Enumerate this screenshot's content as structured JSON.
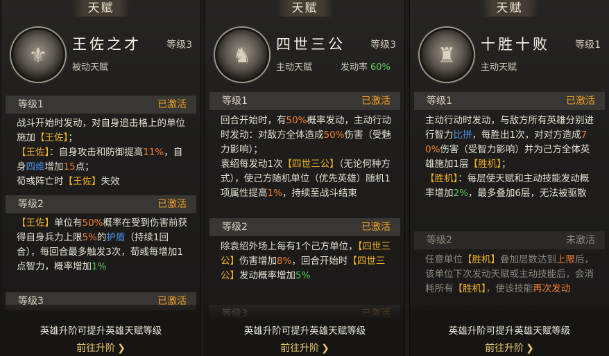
{
  "panels": [
    {
      "title": "天赋",
      "name": "王佐之才",
      "level": "等级3",
      "type": "被动天赋",
      "rate_label": "",
      "rate_value": "",
      "avatar_glyph": "⚜",
      "tiers": [
        {
          "label": "等级1",
          "status": "已激活",
          "active": true,
          "segments": [
            [
              "",
              "战斗开始时发动，对自身追击格上的单位施加"
            ],
            [
              "y",
              "【王佐】"
            ],
            [
              "",
              "；"
            ],
            [
              "br",
              ""
            ],
            [
              "y",
              "【王佐】"
            ],
            [
              "",
              "：自身攻击和防御提高"
            ],
            [
              "o",
              "11%"
            ],
            [
              "",
              "，自身"
            ],
            [
              "b",
              "四维"
            ],
            [
              "",
              "增加"
            ],
            [
              "o",
              "15"
            ],
            [
              "",
              "点；"
            ],
            [
              "br",
              ""
            ],
            [
              "",
              "荀彧阵亡时"
            ],
            [
              "y",
              "【王佐】"
            ],
            [
              "",
              "失效"
            ]
          ]
        },
        {
          "label": "等级2",
          "status": "已激活",
          "active": true,
          "segments": [
            [
              "y",
              "【王佐】"
            ],
            [
              "",
              "单位有"
            ],
            [
              "o",
              "50%"
            ],
            [
              "",
              "概率在受到伤害前获得自身兵力上限"
            ],
            [
              "o",
              "5%"
            ],
            [
              "",
              "的"
            ],
            [
              "b",
              "护盾"
            ],
            [
              "",
              "（持续1回合），每回合最多触发3次，荀彧每增加1点智力，概率增加"
            ],
            [
              "g",
              "1%"
            ]
          ]
        },
        {
          "label": "等级3",
          "status": "已激活",
          "active": true,
          "segments": []
        }
      ],
      "footer_note": "英雄升阶可提升英雄天赋等级",
      "footer_button": "前往升阶"
    },
    {
      "title": "天赋",
      "name": "四世三公",
      "level": "等级3",
      "type": "主动天赋",
      "rate_label": "发动率",
      "rate_value": "60%",
      "avatar_glyph": "♞",
      "tiers": [
        {
          "label": "等级1",
          "status": "已激活",
          "active": true,
          "segments": [
            [
              "",
              "回合开始时，有"
            ],
            [
              "o",
              "50%"
            ],
            [
              "",
              "概率发动，主动行动时发动：对敌方全体造成"
            ],
            [
              "o",
              "50%"
            ],
            [
              "",
              "伤害（受魅力影响）；"
            ],
            [
              "br",
              ""
            ],
            [
              "",
              "袁绍每发动1次"
            ],
            [
              "y",
              "【四世三公】"
            ],
            [
              "",
              "（无论何种方式），使己方随机单位（优先英雄）随机1项属性提高"
            ],
            [
              "o",
              "1%"
            ],
            [
              "",
              "，持续至战斗结束"
            ]
          ]
        },
        {
          "label": "等级2",
          "status": "已激活",
          "active": true,
          "segments": [
            [
              "",
              "除袁绍外场上每有1个己方单位，"
            ],
            [
              "y",
              "【四世三公】"
            ],
            [
              "",
              "伤害增加"
            ],
            [
              "o",
              "8%"
            ],
            [
              "",
              "，回合开始时"
            ],
            [
              "y",
              "【四世三公】"
            ],
            [
              "",
              "发动概率增加"
            ],
            [
              "g",
              "5%"
            ]
          ]
        },
        {
          "label": "等级3",
          "status": "已激活",
          "active": true,
          "segments": []
        }
      ],
      "footer_note": "英雄升阶可提升英雄天赋等级",
      "footer_button": "前往升阶"
    },
    {
      "title": "天赋",
      "name": "十胜十败",
      "level": "等级1",
      "type": "主动天赋",
      "rate_label": "",
      "rate_value": "",
      "avatar_glyph": "♜",
      "tiers": [
        {
          "label": "等级1",
          "status": "已激活",
          "active": true,
          "segments": [
            [
              "",
              "主动行动时发动，与敌方所有英雄分别进行智力"
            ],
            [
              "b",
              "比拼"
            ],
            [
              "",
              "，每胜出1次，对对方造成"
            ],
            [
              "o",
              "70%"
            ],
            [
              "",
              "伤害（受智力影响）并为己方全体英雄施加1层"
            ],
            [
              "y",
              "【胜机】"
            ],
            [
              "",
              "；"
            ],
            [
              "br",
              ""
            ],
            [
              "y",
              "【胜机】"
            ],
            [
              "",
              "：每层使天赋和主动技能发动概率增加"
            ],
            [
              "g",
              "2%"
            ],
            [
              "",
              "，最多叠加6层，无法被驱散"
            ]
          ]
        },
        {
          "label": "等级2",
          "status": "未激活",
          "active": false,
          "segments": [
            [
              "",
              "任意单位"
            ],
            [
              "y",
              "【胜机】"
            ],
            [
              "",
              "叠加层数达到"
            ],
            [
              "o",
              "上限"
            ],
            [
              "",
              "后，该单位下次发动天赋或主动技能后，会消耗所有"
            ],
            [
              "y",
              "【胜机】"
            ],
            [
              "",
              "，使该技能"
            ],
            [
              "o",
              "再次发动"
            ]
          ]
        }
      ],
      "footer_note": "英雄升阶可提升英雄天赋等级",
      "footer_button": "前往升阶"
    }
  ]
}
